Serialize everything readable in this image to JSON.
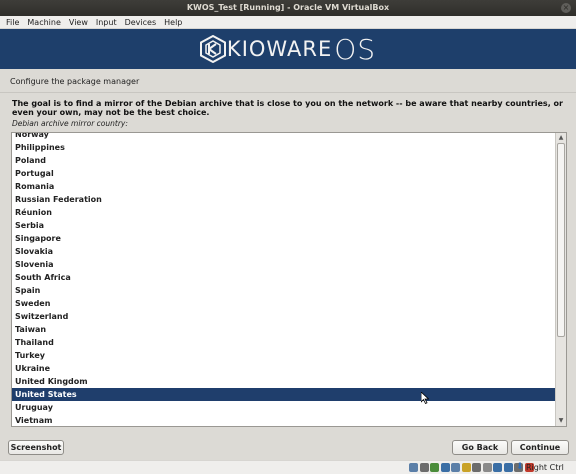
{
  "window": {
    "title": "KWOS_Test [Running] - Oracle VM VirtualBox",
    "close_glyph": "×"
  },
  "menubar": {
    "items": [
      "File",
      "Machine",
      "View",
      "Input",
      "Devices",
      "Help"
    ]
  },
  "banner": {
    "logo_text": "KIOWARE",
    "logo_suffix": "OS"
  },
  "installer": {
    "step_title": "Configure the package manager",
    "description": "The goal is to find a mirror of the Debian archive that is close to you on the network -- be aware that nearby countries, or even your own, may not be the best choice.",
    "field_label": "Debian archive mirror country:",
    "countries": [
      "Norway",
      "Philippines",
      "Poland",
      "Portugal",
      "Romania",
      "Russian Federation",
      "Réunion",
      "Serbia",
      "Singapore",
      "Slovakia",
      "Slovenia",
      "South Africa",
      "Spain",
      "Sweden",
      "Switzerland",
      "Taiwan",
      "Thailand",
      "Turkey",
      "Ukraine",
      "United Kingdom",
      "United States",
      "Uruguay",
      "Vietnam"
    ],
    "selected": "United States",
    "buttons": {
      "screenshot": "Screenshot",
      "back": "Go Back",
      "continue": "Continue"
    }
  },
  "statusbar": {
    "host_key": "Right Ctrl",
    "icon_names": [
      "hard-disk-icon",
      "optical-drive-icon",
      "audio-icon",
      "network-icon",
      "usb-icon",
      "shared-folder-icon",
      "display-icon",
      "capture-icon",
      "mouse-integration-icon",
      "keyboard-icon",
      "cpu-icon",
      "recording-icon"
    ]
  },
  "colors": {
    "banner": "#1e3f6b",
    "selection": "#1f3e6c",
    "titlebar": "#3e3d39"
  }
}
